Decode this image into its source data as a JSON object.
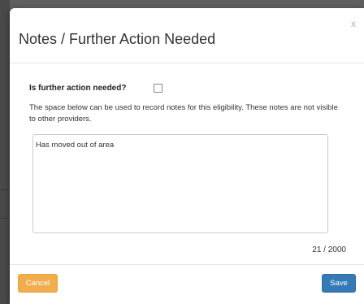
{
  "modal": {
    "title": "Notes / Further Action Needed",
    "close_label": "x"
  },
  "form": {
    "further_action_label": "Is further action needed?",
    "further_action_checked": false,
    "help_text": "The space below can be used to record notes for this eligibility. These notes are not visible to other providers.",
    "notes_value": "Has moved out of area",
    "char_count": "21 / 2000"
  },
  "footer": {
    "cancel_label": "Cancel",
    "save_label": "Save"
  },
  "colors": {
    "cancel": "#f0ad4e",
    "save": "#337ab7",
    "overlay": "#5f5f5f"
  }
}
